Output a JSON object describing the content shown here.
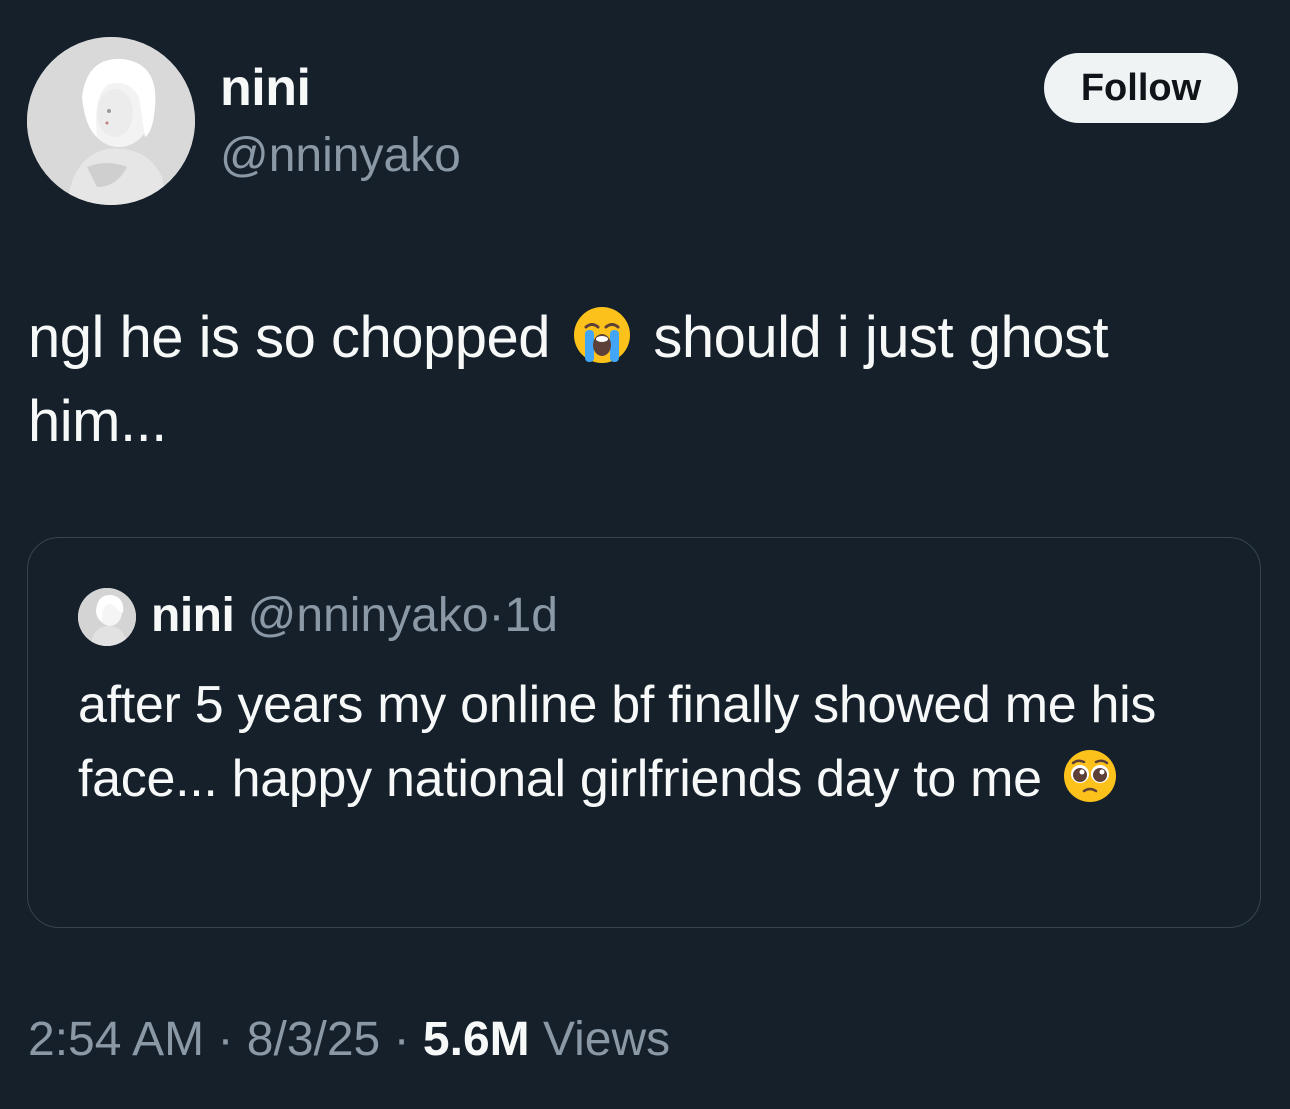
{
  "author": {
    "display_name": "nini",
    "handle": "@nninyako",
    "avatar_icon": "profile-avatar"
  },
  "follow_button": {
    "label": "Follow"
  },
  "tweet": {
    "text_part1": "ngl he is so chopped",
    "emoji1": "loudly-crying-face-emoji",
    "text_part2": "should i just ghost him..."
  },
  "quoted_tweet": {
    "display_name": "nini",
    "handle": "@nninyako",
    "dot": "·",
    "time": "1d",
    "text": "after 5 years my online bf finally showed me his face... happy national girlfriends day to me",
    "emoji": "pleading-face-emoji"
  },
  "meta": {
    "time": "2:54 AM",
    "dot1": "·",
    "date": "8/3/25",
    "dot2": "·",
    "views_count": "5.6M",
    "views_label": "Views"
  },
  "colors": {
    "background": "#15202b",
    "primary_text": "#f7f9f9",
    "secondary_text": "#8b98a5",
    "border": "#38444d",
    "button_bg": "#eff3f4"
  }
}
